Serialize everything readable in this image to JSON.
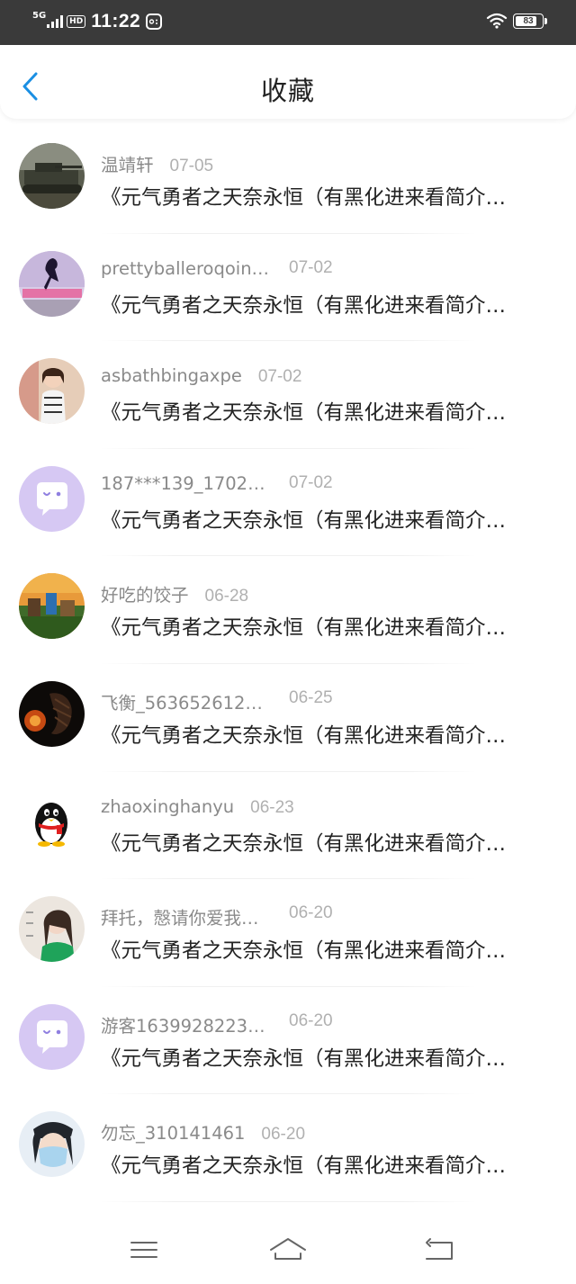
{
  "status_bar": {
    "network": "5G",
    "hd": "HD",
    "time": "11:22",
    "battery": "83",
    "battery_level": 0.83
  },
  "header": {
    "title": "收藏",
    "back_icon": "chevron-left-icon",
    "accent_color": "#1a8fe3"
  },
  "items": [
    {
      "user": "温靖轩",
      "date": "07-05",
      "title": "《元气勇者之天奈永恒（有黑化进来看简介…",
      "avatar": "tank-photo"
    },
    {
      "user": "prettyballeroqoin…",
      "date": "07-02",
      "title": "《元气勇者之天奈永恒（有黑化进来看简介…",
      "avatar": "ballerina-silhouette"
    },
    {
      "user": "asbathbingaxpe",
      "date": "07-02",
      "title": "《元气勇者之天奈永恒（有黑化进来看简介…",
      "avatar": "girl-photo"
    },
    {
      "user": "187***139_1702…",
      "date": "07-02",
      "title": "《元气勇者之天奈永恒（有黑化进来看简介…",
      "avatar": "default-chat-avatar"
    },
    {
      "user": "好吃的饺子",
      "date": "06-28",
      "title": "《元气勇者之天奈永恒（有黑化进来看简介…",
      "avatar": "game-scene"
    },
    {
      "user": "飞衡_563652612…",
      "date": "06-25",
      "title": "《元气勇者之天奈永恒（有黑化进来看简介…",
      "avatar": "dark-fire-character"
    },
    {
      "user": "zhaoxinghanyu",
      "date": "06-23",
      "title": "《元气勇者之天奈永恒（有黑化进来看简介…",
      "avatar": "qq-penguin"
    },
    {
      "user": "拜托，慤请你爱我…",
      "date": "06-20",
      "title": "《元气勇者之天奈永恒（有黑化进来看简介…",
      "avatar": "girl-green-scarf"
    },
    {
      "user": "游客1639928223…",
      "date": "06-20",
      "title": "《元气勇者之天奈永恒（有黑化进来看简介…",
      "avatar": "default-chat-avatar"
    },
    {
      "user": "勿忘_310141461",
      "date": "06-20",
      "title": "《元气勇者之天奈永恒（有黑化进来看简介…",
      "avatar": "masked-girl"
    }
  ],
  "navbar": {
    "menu_icon": "menu-icon",
    "home_icon": "home-icon",
    "back_icon": "back-icon"
  }
}
